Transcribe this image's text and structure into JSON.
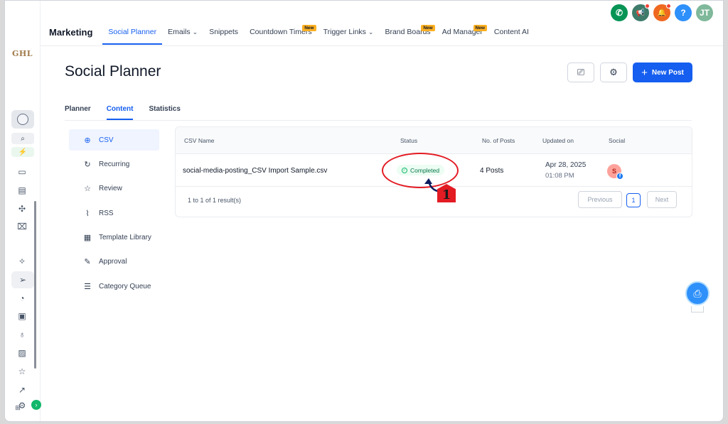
{
  "app": {
    "logo_text": "GHL"
  },
  "topbar": {
    "section_title": "Marketing",
    "nav": [
      {
        "label": "Social Planner",
        "active": true,
        "dropdown": false,
        "badge": ""
      },
      {
        "label": "Emails",
        "active": false,
        "dropdown": true,
        "badge": ""
      },
      {
        "label": "Snippets",
        "active": false,
        "dropdown": false,
        "badge": ""
      },
      {
        "label": "Countdown Timers",
        "active": false,
        "dropdown": false,
        "badge": "New"
      },
      {
        "label": "Trigger Links",
        "active": false,
        "dropdown": true,
        "badge": ""
      },
      {
        "label": "Brand Boards",
        "active": false,
        "dropdown": false,
        "badge": "New"
      },
      {
        "label": "Ad Manager",
        "active": false,
        "dropdown": false,
        "badge": "New"
      },
      {
        "label": "Content AI",
        "active": false,
        "dropdown": false,
        "badge": ""
      }
    ],
    "icons": [
      {
        "name": "phone-icon",
        "glyph": "✆",
        "color": "#079455",
        "dot": false
      },
      {
        "name": "megaphone-icon",
        "glyph": "📢",
        "color": "#3e7b6a",
        "dot": true
      },
      {
        "name": "bell-icon",
        "glyph": "🔔",
        "color": "#ef6820",
        "dot": true
      },
      {
        "name": "help-icon",
        "glyph": "?",
        "color": "#2e90fa",
        "dot": false
      },
      {
        "name": "user-avatar",
        "glyph": "JT",
        "color": "#7fb89a",
        "dot": false
      }
    ]
  },
  "page": {
    "title": "Social Planner",
    "new_post_label": "New Post"
  },
  "tabs": [
    {
      "label": "Planner",
      "active": false
    },
    {
      "label": "Content",
      "active": true
    },
    {
      "label": "Statistics",
      "active": false
    }
  ],
  "submenu": [
    {
      "label": "CSV",
      "icon": "upload-icon",
      "glyph": "⊕",
      "active": true
    },
    {
      "label": "Recurring",
      "icon": "recurring-icon",
      "glyph": "↻",
      "active": false
    },
    {
      "label": "Review",
      "icon": "star-icon",
      "glyph": "☆",
      "active": false
    },
    {
      "label": "RSS",
      "icon": "rss-icon",
      "glyph": "⌇",
      "active": false
    },
    {
      "label": "Template Library",
      "icon": "template-icon",
      "glyph": "▦",
      "active": false
    },
    {
      "label": "Approval",
      "icon": "approval-icon",
      "glyph": "✎",
      "active": false
    },
    {
      "label": "Category Queue",
      "icon": "queue-icon",
      "glyph": "☰",
      "active": false
    }
  ],
  "table": {
    "headers": {
      "name": "CSV Name",
      "status": "Status",
      "posts": "No. of Posts",
      "updated": "Updated on",
      "social": "Social"
    },
    "rows": [
      {
        "name": "social-media-posting_CSV Import Sample.csv",
        "status": "Completed",
        "posts": "4 Posts",
        "date": "Apr 28, 2025",
        "time": "01:08 PM",
        "social_initial": "S",
        "social_network": "f"
      }
    ],
    "results_text": "1 to 1 of 1 result(s)",
    "pagination": {
      "previous": "Previous",
      "page": "1",
      "next": "Next"
    }
  },
  "annotation": {
    "step_number": "1",
    "color": "#e31b23"
  },
  "colors": {
    "accent": "#155eef",
    "success": "#12b76a",
    "badge_new": "#fdb022"
  }
}
